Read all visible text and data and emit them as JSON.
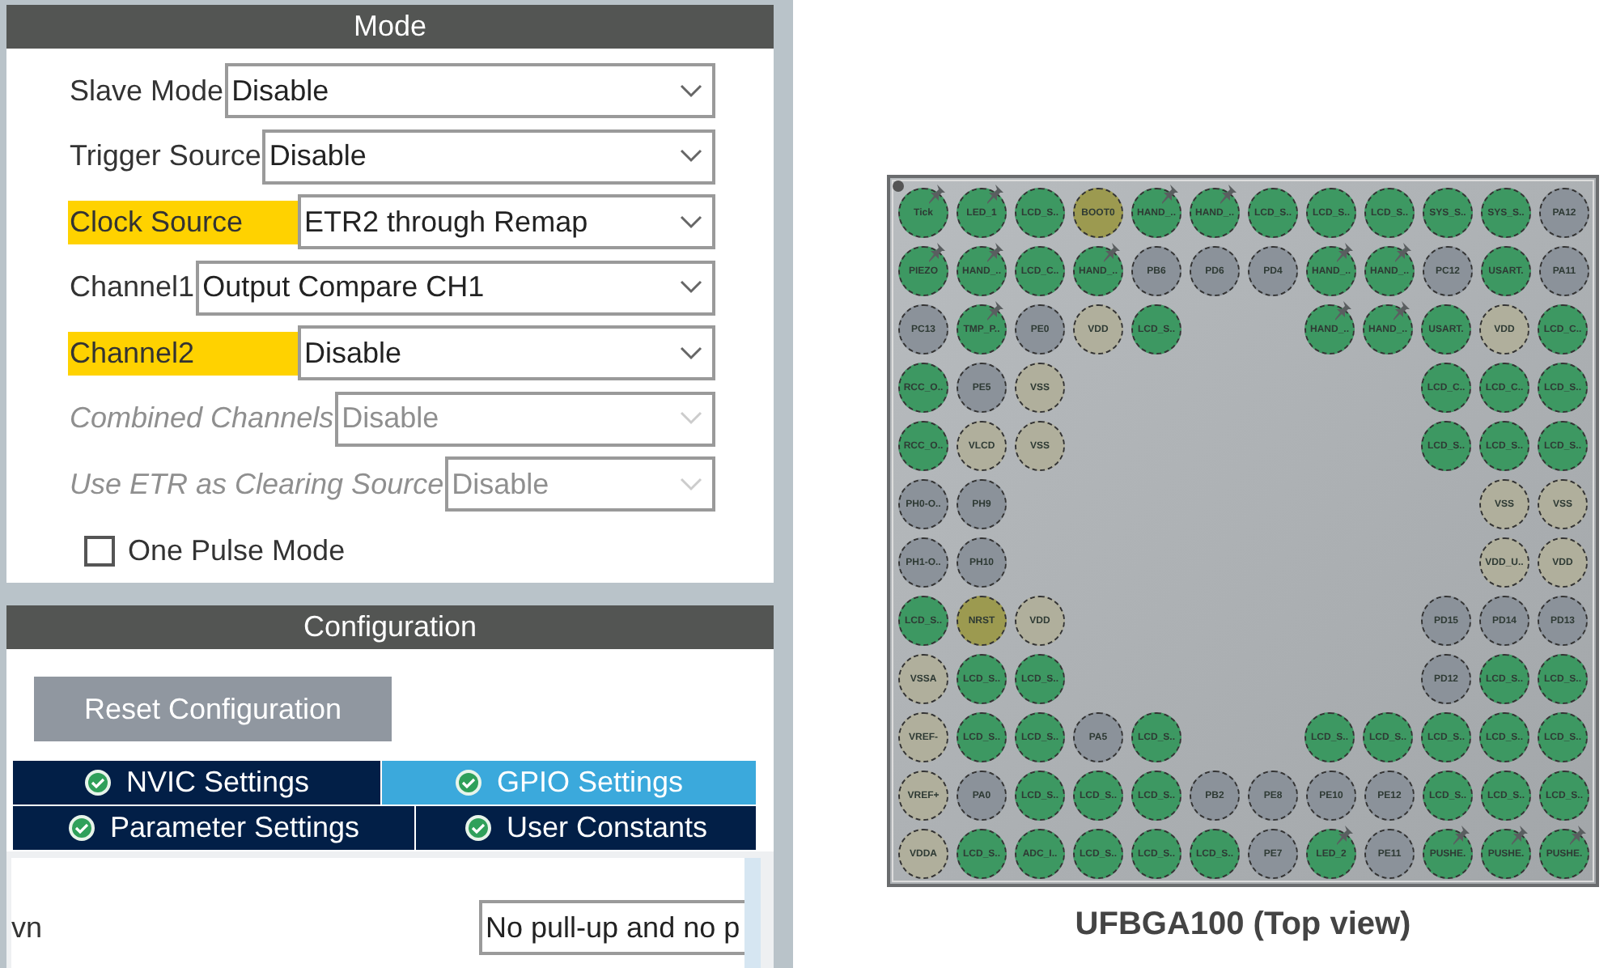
{
  "mode": {
    "title": "Mode",
    "fields": [
      {
        "label": "Slave Mode",
        "value": "Disable",
        "highlighted": false,
        "disabled": false
      },
      {
        "label": "Trigger Source",
        "value": "Disable",
        "highlighted": false,
        "disabled": false
      },
      {
        "label": "Clock Source",
        "value": "ETR2 through Remap",
        "highlighted": true,
        "disabled": false
      },
      {
        "label": "Channel1",
        "value": "Output Compare CH1",
        "highlighted": false,
        "disabled": false
      },
      {
        "label": "Channel2",
        "value": "Disable",
        "highlighted": true,
        "disabled": false
      },
      {
        "label": "Combined Channels",
        "value": "Disable",
        "highlighted": false,
        "disabled": true
      },
      {
        "label": "Use ETR as Clearing Source",
        "value": "Disable",
        "highlighted": false,
        "disabled": true
      }
    ],
    "checkbox": {
      "label": "One Pulse Mode",
      "checked": false
    }
  },
  "configuration": {
    "title": "Configuration",
    "reset_button": "Reset Configuration",
    "tabs": [
      {
        "label": "NVIC Settings",
        "selected": false
      },
      {
        "label": "GPIO Settings",
        "selected": true
      },
      {
        "label": "Parameter Settings",
        "selected": false
      },
      {
        "label": "User Constants",
        "selected": false
      }
    ],
    "row_label": "vn",
    "row_value": "No pull-up and no p"
  },
  "chip": {
    "caption": "UFBGA100 (Top view)",
    "rows": [
      {
        "left": [
          {
            "label": "Tick",
            "kind": "assigned",
            "pinned": true
          },
          {
            "label": "LED_1",
            "kind": "assigned",
            "pinned": true
          },
          {
            "label": "LCD_S..",
            "kind": "assigned",
            "pinned": false
          },
          {
            "label": "BOOT0",
            "kind": "special",
            "pinned": false
          },
          {
            "label": "HAND_..",
            "kind": "assigned",
            "pinned": true
          },
          {
            "label": "HAND_..",
            "kind": "assigned",
            "pinned": true
          },
          {
            "label": "LCD_S..",
            "kind": "assigned",
            "pinned": false
          },
          {
            "label": "LCD_S..",
            "kind": "assigned",
            "pinned": false
          },
          {
            "label": "LCD_S..",
            "kind": "assigned",
            "pinned": false
          },
          {
            "label": "SYS_S..",
            "kind": "assigned",
            "pinned": false
          },
          {
            "label": "SYS_S..",
            "kind": "assigned",
            "pinned": false
          },
          {
            "label": "PA12",
            "kind": "gpio",
            "pinned": false
          }
        ],
        "right": []
      },
      {
        "left": [
          {
            "label": "PIEZO",
            "kind": "assigned",
            "pinned": true
          },
          {
            "label": "HAND_..",
            "kind": "assigned",
            "pinned": true
          },
          {
            "label": "LCD_C..",
            "kind": "assigned",
            "pinned": false
          },
          {
            "label": "HAND_..",
            "kind": "assigned",
            "pinned": true
          },
          {
            "label": "PB6",
            "kind": "gpio",
            "pinned": false
          },
          {
            "label": "PD6",
            "kind": "gpio",
            "pinned": false
          },
          {
            "label": "PD4",
            "kind": "gpio",
            "pinned": false
          },
          {
            "label": "HAND_..",
            "kind": "assigned",
            "pinned": true
          },
          {
            "label": "HAND_..",
            "kind": "assigned",
            "pinned": true
          },
          {
            "label": "PC12",
            "kind": "gpio",
            "pinned": false
          },
          {
            "label": "USART.",
            "kind": "assigned",
            "pinned": false
          },
          {
            "label": "PA11",
            "kind": "gpio",
            "pinned": false
          }
        ],
        "right": []
      },
      {
        "left": [
          {
            "label": "PC13",
            "kind": "gpio",
            "pinned": false
          },
          {
            "label": "TMP_P..",
            "kind": "assigned",
            "pinned": true
          },
          {
            "label": "PE0",
            "kind": "gpio",
            "pinned": false
          },
          {
            "label": "VDD",
            "kind": "power",
            "pinned": false
          },
          {
            "label": "LCD_S..",
            "kind": "assigned",
            "pinned": false
          }
        ],
        "right": [
          {
            "label": "HAND_..",
            "kind": "assigned",
            "pinned": true
          },
          {
            "label": "HAND_..",
            "kind": "assigned",
            "pinned": true
          },
          {
            "label": "USART.",
            "kind": "assigned",
            "pinned": false
          },
          {
            "label": "VDD",
            "kind": "power",
            "pinned": false
          },
          {
            "label": "LCD_C..",
            "kind": "assigned",
            "pinned": false
          }
        ]
      },
      {
        "left": [
          {
            "label": "RCC_O..",
            "kind": "assigned",
            "pinned": false
          },
          {
            "label": "PE5",
            "kind": "gpio",
            "pinned": false
          },
          {
            "label": "VSS",
            "kind": "power",
            "pinned": false
          }
        ],
        "right": [
          {
            "label": "LCD_C..",
            "kind": "assigned",
            "pinned": false
          },
          {
            "label": "LCD_C..",
            "kind": "assigned",
            "pinned": false
          },
          {
            "label": "LCD_S..",
            "kind": "assigned",
            "pinned": false
          }
        ]
      },
      {
        "left": [
          {
            "label": "RCC_O..",
            "kind": "assigned",
            "pinned": false
          },
          {
            "label": "VLCD",
            "kind": "power",
            "pinned": false
          },
          {
            "label": "VSS",
            "kind": "power",
            "pinned": false
          }
        ],
        "right": [
          {
            "label": "LCD_S..",
            "kind": "assigned",
            "pinned": false
          },
          {
            "label": "LCD_S..",
            "kind": "assigned",
            "pinned": false
          },
          {
            "label": "LCD_S..",
            "kind": "assigned",
            "pinned": false
          }
        ]
      },
      {
        "left": [
          {
            "label": "PH0-O..",
            "kind": "gpio",
            "pinned": false
          },
          {
            "label": "PH9",
            "kind": "gpio",
            "pinned": false
          }
        ],
        "right": [
          {
            "label": "VSS",
            "kind": "power",
            "pinned": false
          },
          {
            "label": "VSS",
            "kind": "power",
            "pinned": false
          }
        ]
      },
      {
        "left": [
          {
            "label": "PH1-O..",
            "kind": "gpio",
            "pinned": false
          },
          {
            "label": "PH10",
            "kind": "gpio",
            "pinned": false
          }
        ],
        "right": [
          {
            "label": "VDD_U..",
            "kind": "power",
            "pinned": false
          },
          {
            "label": "VDD",
            "kind": "power",
            "pinned": false
          }
        ]
      },
      {
        "left": [
          {
            "label": "LCD_S..",
            "kind": "assigned",
            "pinned": false
          },
          {
            "label": "NRST",
            "kind": "special",
            "pinned": false
          },
          {
            "label": "VDD",
            "kind": "power",
            "pinned": false
          }
        ],
        "right": [
          {
            "label": "PD15",
            "kind": "gpio",
            "pinned": false
          },
          {
            "label": "PD14",
            "kind": "gpio",
            "pinned": false
          },
          {
            "label": "PD13",
            "kind": "gpio",
            "pinned": false
          }
        ]
      },
      {
        "left": [
          {
            "label": "VSSA",
            "kind": "power",
            "pinned": false
          },
          {
            "label": "LCD_S..",
            "kind": "assigned",
            "pinned": false
          },
          {
            "label": "LCD_S..",
            "kind": "assigned",
            "pinned": false
          }
        ],
        "right": [
          {
            "label": "PD12",
            "kind": "gpio",
            "pinned": false
          },
          {
            "label": "LCD_S..",
            "kind": "assigned",
            "pinned": false
          },
          {
            "label": "LCD_S..",
            "kind": "assigned",
            "pinned": false
          }
        ]
      },
      {
        "left": [
          {
            "label": "VREF-",
            "kind": "power",
            "pinned": false
          },
          {
            "label": "LCD_S..",
            "kind": "assigned",
            "pinned": false
          },
          {
            "label": "LCD_S..",
            "kind": "assigned",
            "pinned": false
          },
          {
            "label": "PA5",
            "kind": "gpio",
            "pinned": false
          },
          {
            "label": "LCD_S..",
            "kind": "assigned",
            "pinned": false
          }
        ],
        "right": [
          {
            "label": "LCD_S..",
            "kind": "assigned",
            "pinned": false
          },
          {
            "label": "LCD_S..",
            "kind": "assigned",
            "pinned": false
          },
          {
            "label": "LCD_S..",
            "kind": "assigned",
            "pinned": false
          },
          {
            "label": "LCD_S..",
            "kind": "assigned",
            "pinned": false
          },
          {
            "label": "LCD_S..",
            "kind": "assigned",
            "pinned": false
          }
        ]
      },
      {
        "left": [
          {
            "label": "VREF+",
            "kind": "power",
            "pinned": false
          },
          {
            "label": "PA0",
            "kind": "gpio",
            "pinned": false
          },
          {
            "label": "LCD_S..",
            "kind": "assigned",
            "pinned": false
          },
          {
            "label": "LCD_S..",
            "kind": "assigned",
            "pinned": false
          },
          {
            "label": "LCD_S..",
            "kind": "assigned",
            "pinned": false
          },
          {
            "label": "PB2",
            "kind": "gpio",
            "pinned": false
          },
          {
            "label": "PE8",
            "kind": "gpio",
            "pinned": false
          },
          {
            "label": "PE10",
            "kind": "gpio",
            "pinned": false
          },
          {
            "label": "PE12",
            "kind": "gpio",
            "pinned": false
          },
          {
            "label": "LCD_S..",
            "kind": "assigned",
            "pinned": false
          },
          {
            "label": "LCD_S..",
            "kind": "assigned",
            "pinned": false
          },
          {
            "label": "LCD_S..",
            "kind": "assigned",
            "pinned": false
          }
        ],
        "right": []
      },
      {
        "left": [
          {
            "label": "VDDA",
            "kind": "power",
            "pinned": false
          },
          {
            "label": "LCD_S..",
            "kind": "assigned",
            "pinned": false
          },
          {
            "label": "ADC_I..",
            "kind": "assigned",
            "pinned": false
          },
          {
            "label": "LCD_S..",
            "kind": "assigned",
            "pinned": false
          },
          {
            "label": "LCD_S..",
            "kind": "assigned",
            "pinned": false
          },
          {
            "label": "LCD_S..",
            "kind": "assigned",
            "pinned": false
          },
          {
            "label": "PE7",
            "kind": "gpio",
            "pinned": false
          },
          {
            "label": "LED_2",
            "kind": "assigned",
            "pinned": true
          },
          {
            "label": "PE11",
            "kind": "gpio",
            "pinned": false
          },
          {
            "label": "PUSHE.",
            "kind": "assigned",
            "pinned": true
          },
          {
            "label": "PUSHE.",
            "kind": "assigned",
            "pinned": true
          },
          {
            "label": "PUSHE.",
            "kind": "assigned",
            "pinned": true
          }
        ],
        "right": []
      }
    ]
  }
}
